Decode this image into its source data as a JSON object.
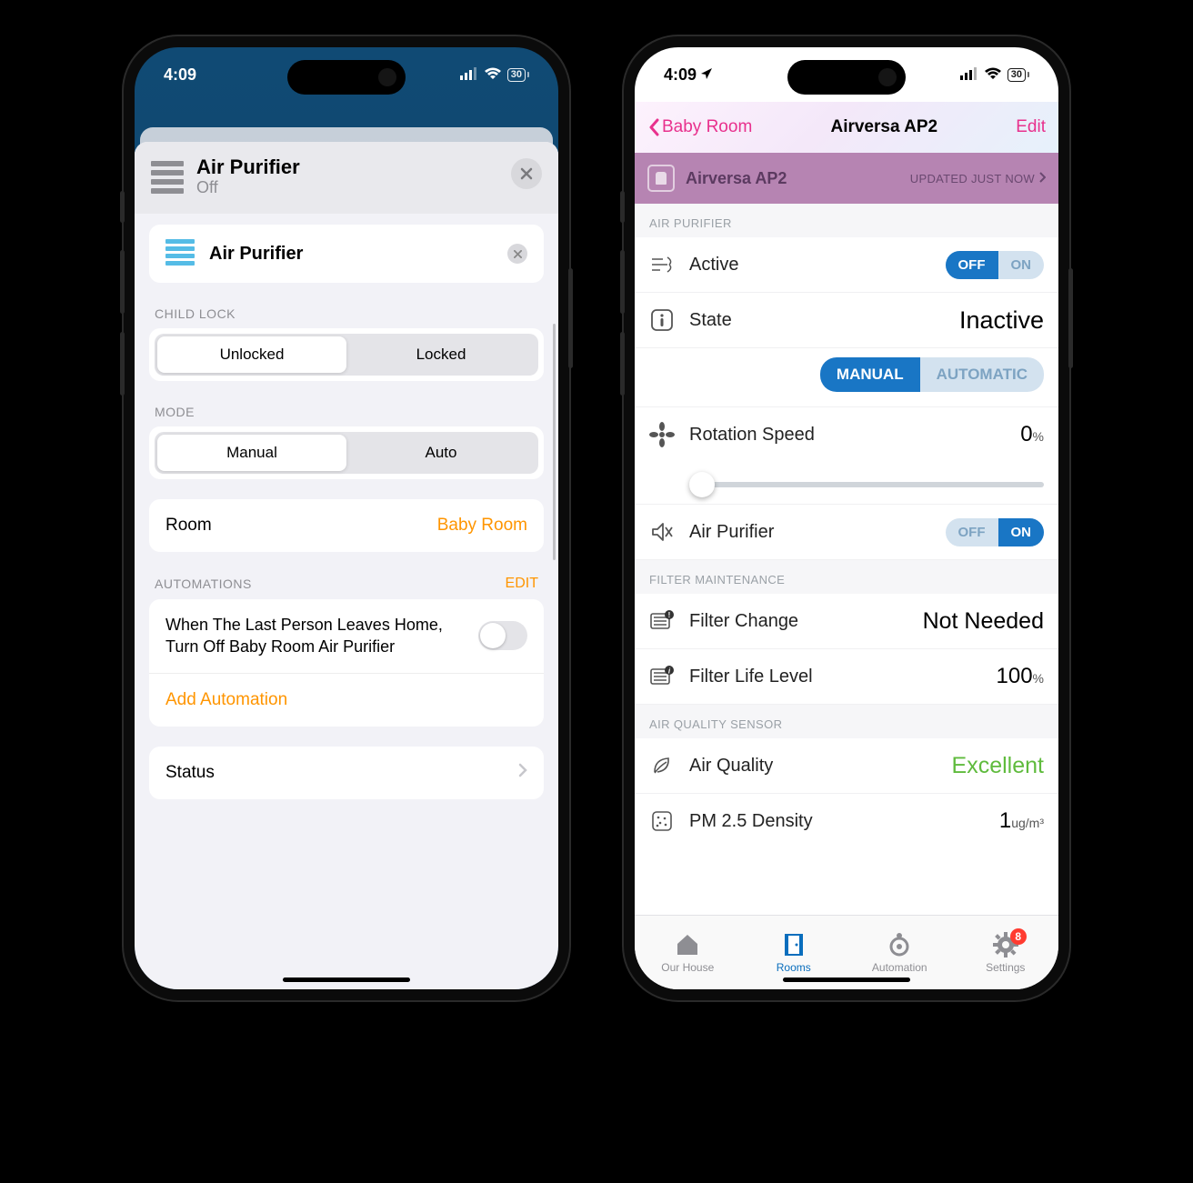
{
  "status": {
    "time": "4:09",
    "battery": "30"
  },
  "left": {
    "header": {
      "title": "Air Purifier",
      "subtitle": "Off"
    },
    "rename": {
      "value": "Air Purifier"
    },
    "child_lock": {
      "label": "CHILD LOCK",
      "opts": [
        "Unlocked",
        "Locked"
      ],
      "active": 0
    },
    "mode": {
      "label": "MODE",
      "opts": [
        "Manual",
        "Auto"
      ],
      "active": 0
    },
    "room": {
      "label": "Room",
      "value": "Baby Room"
    },
    "automations": {
      "label": "AUTOMATIONS",
      "edit": "EDIT",
      "item": "When The Last Person Leaves Home, Turn Off Baby Room Air Purifier",
      "add": "Add Automation"
    },
    "status_row": "Status"
  },
  "right": {
    "back": "Baby Room",
    "title": "Airversa AP2",
    "edit": "Edit",
    "bar": {
      "name": "Airversa AP2",
      "updated": "UPDATED JUST NOW"
    },
    "sec_purifier": "AIR PURIFIER",
    "active": {
      "label": "Active",
      "opts": [
        "OFF",
        "ON"
      ],
      "active": 0
    },
    "state": {
      "label": "State",
      "value": "Inactive"
    },
    "mode": {
      "opts": [
        "MANUAL",
        "AUTOMATIC"
      ],
      "active": 0
    },
    "speed": {
      "label": "Rotation Speed",
      "value": "0",
      "unit": "%"
    },
    "purifier_toggle": {
      "label": "Air Purifier",
      "opts": [
        "OFF",
        "ON"
      ],
      "active": 1
    },
    "sec_filter": "FILTER MAINTENANCE",
    "filter_change": {
      "label": "Filter Change",
      "value": "Not Needed"
    },
    "filter_life": {
      "label": "Filter Life Level",
      "value": "100",
      "unit": "%"
    },
    "sec_aq": "AIR QUALITY SENSOR",
    "air_quality": {
      "label": "Air Quality",
      "value": "Excellent"
    },
    "pm25": {
      "label": "PM 2.5 Density",
      "value": "1",
      "unit": "ug/m³"
    },
    "tabs": {
      "items": [
        "Our House",
        "Rooms",
        "Automation",
        "Settings"
      ],
      "active": 1,
      "badge": "8"
    }
  }
}
